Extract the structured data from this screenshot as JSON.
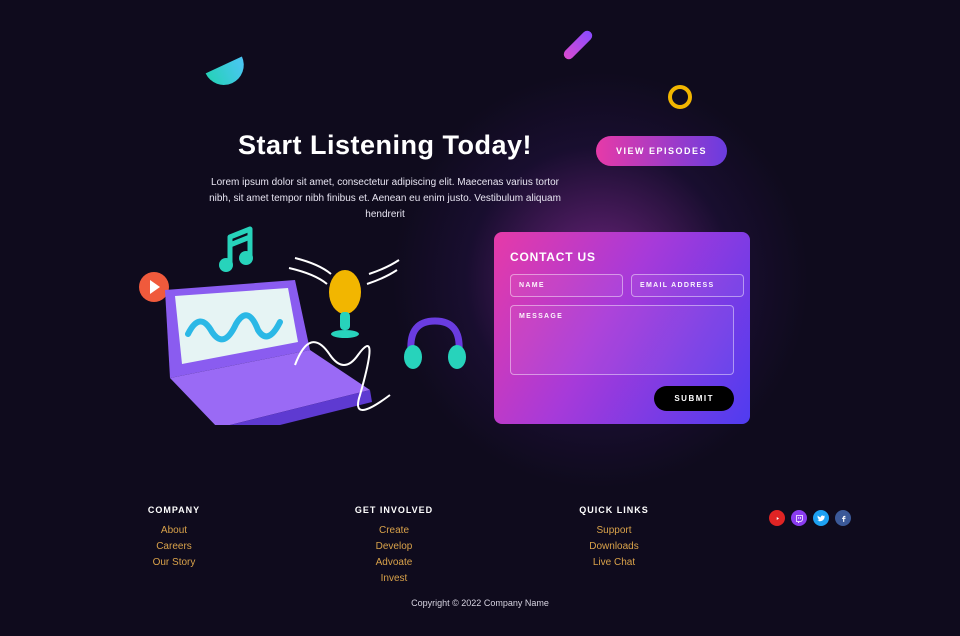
{
  "hero": {
    "title": "Start Listening Today!",
    "subtitle": "Lorem ipsum dolor sit amet, consectetur adipiscing elit. Maecenas varius tortor nibh, sit amet tempor nibh finibus et. Aenean eu enim justo. Vestibulum aliquam hendrerit"
  },
  "cta": {
    "view_episodes": "VIEW EPISODES"
  },
  "contact": {
    "heading": "CONTACT US",
    "name_placeholder": "NAME",
    "email_placeholder": "EMAIL ADDRESS",
    "message_placeholder": "MESSAGE",
    "submit": "SUBMIT"
  },
  "footer": {
    "cols": [
      {
        "heading": "COMPANY",
        "links": [
          "About",
          "Careers",
          "Our Story"
        ]
      },
      {
        "heading": "GET INVOLVED",
        "links": [
          "Create",
          "Develop",
          "Advoate",
          "Invest"
        ]
      },
      {
        "heading": "QUICK LINKS",
        "links": [
          "Support",
          "Downloads",
          "Live Chat"
        ]
      }
    ],
    "copyright": "Copyright © 2022 Company Name"
  },
  "socials": [
    "youtube",
    "twitch",
    "twitter",
    "facebook"
  ]
}
